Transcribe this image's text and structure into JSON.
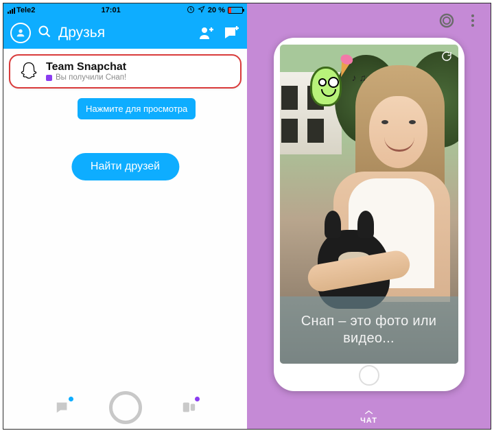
{
  "statusbar": {
    "carrier": "Tele2",
    "time": "17:01",
    "battery_percent": "20 %"
  },
  "header": {
    "title": "Друзья"
  },
  "chat_card": {
    "title": "Team Snapchat",
    "subtitle": "Вы получили Cнап!"
  },
  "tooltip": "Нажмите для просмотра",
  "find_friends_button": "Найти друзей",
  "snap_viewer": {
    "caption": "Снап – это фото или видео...",
    "chat_label": "ЧАТ"
  },
  "icons": {
    "ghost": "ghost-icon",
    "search": "search-icon",
    "add_friend": "add-friend-icon",
    "new_chat": "new-chat-icon",
    "chat_tab": "chat-tab-icon",
    "stories_tab": "stories-tab-icon",
    "shutter": "shutter-button",
    "ring": "ring-icon",
    "more": "more-icon",
    "reload": "reload-icon",
    "chevron_up": "chevron-up-icon"
  }
}
